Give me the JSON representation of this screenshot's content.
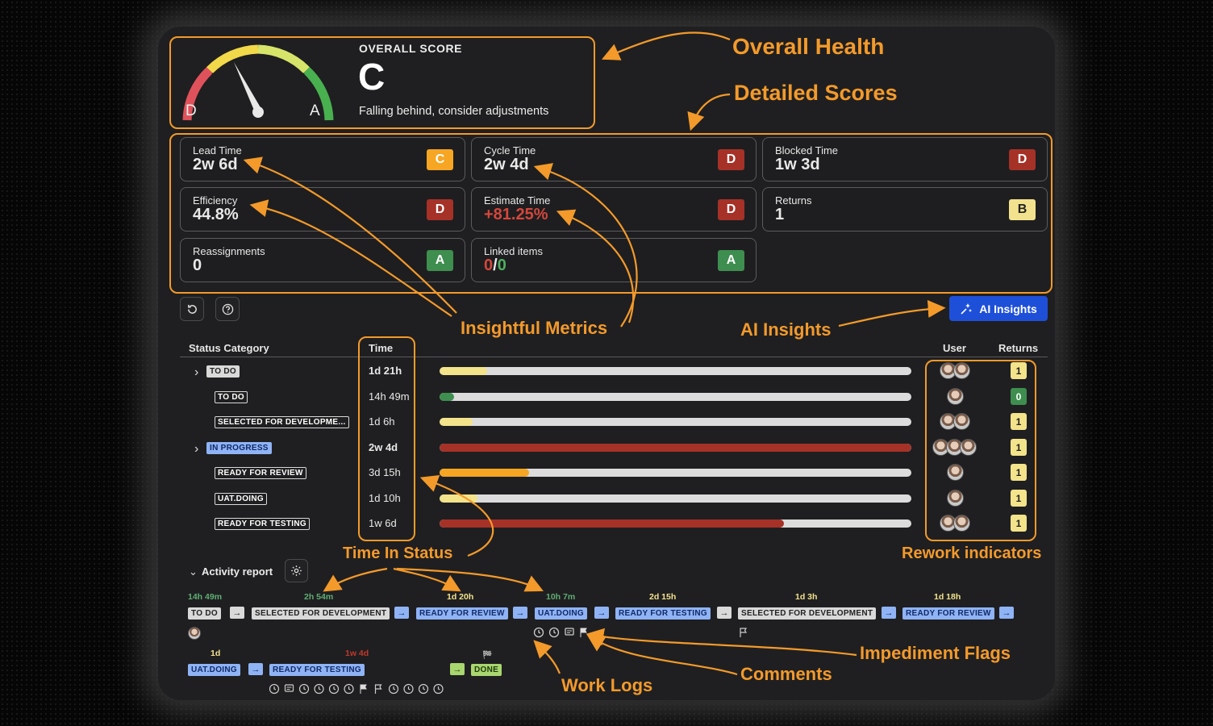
{
  "overall": {
    "heading": "OVERALL SCORE",
    "grade": "C",
    "message": "Falling behind, consider adjustments",
    "gauge_min": "D",
    "gauge_max": "A"
  },
  "metrics": [
    {
      "label": "Lead Time",
      "value": "2w 6d",
      "grade": "C"
    },
    {
      "label": "Cycle Time",
      "value": "2w 4d",
      "grade": "D"
    },
    {
      "label": "Blocked Time",
      "value": "1w 3d",
      "grade": "D"
    },
    {
      "label": "Efficiency",
      "value": "44.8%",
      "grade": "D"
    },
    {
      "label": "Estimate Time",
      "value": "+81.25%",
      "grade": "D"
    },
    {
      "label": "Returns",
      "value": "1",
      "grade": "B"
    },
    {
      "label": "Reassignments",
      "value": "0",
      "grade": "A"
    },
    {
      "label": "Linked items",
      "value_a": "0",
      "sep": "/",
      "value_b": "0",
      "grade": "A"
    }
  ],
  "toolbar": {
    "ai_insights": "AI Insights",
    "refresh_icon": "refresh-icon",
    "help_icon": "help-icon",
    "sparkle_icon": "sparkle-icon"
  },
  "table": {
    "headers": {
      "status": "Status Category",
      "time": "Time",
      "user": "User",
      "returns": "Returns"
    },
    "rows": [
      {
        "status": "TO DO",
        "time": "1d 21h",
        "fill": 0.1,
        "color": "#f3e38b",
        "returns": "1",
        "expandable": true,
        "style": "grey",
        "bold": true
      },
      {
        "status": "TO DO",
        "time": "14h 49m",
        "fill": 0.03,
        "color": "#3e8e4f",
        "returns": "0",
        "style": "outline"
      },
      {
        "status": "SELECTED FOR DEVELOPME...",
        "time": "1d 6h",
        "fill": 0.07,
        "color": "#f3e38b",
        "returns": "1",
        "style": "outline"
      },
      {
        "status": "IN PROGRESS",
        "time": "2w 4d",
        "fill": 1.0,
        "color": "#a63127",
        "returns": "1",
        "expandable": true,
        "style": "blue",
        "bold": true
      },
      {
        "status": "READY FOR REVIEW",
        "time": "3d 15h",
        "fill": 0.19,
        "color": "#f6a623",
        "returns": "1",
        "style": "outline"
      },
      {
        "status": "UAT.DOING",
        "time": "1d 10h",
        "fill": 0.08,
        "color": "#f3e38b",
        "returns": "1",
        "style": "outline"
      },
      {
        "status": "READY FOR TESTING",
        "time": "1w 6d",
        "fill": 0.73,
        "color": "#a63127",
        "returns": "1",
        "style": "outline"
      }
    ]
  },
  "activity": {
    "title": "Activity report",
    "settings_icon": "gear-icon",
    "row1": [
      {
        "dur": "14h 49m",
        "durColor": "#5fae73",
        "status": "TO DO",
        "style": "grey"
      },
      {
        "dur": "2h 54m",
        "durColor": "#5fae73",
        "status": "SELECTED FOR DEVELOPMENT",
        "style": "grey"
      },
      {
        "dur": "1d 20h",
        "durColor": "#f3e38b",
        "status": "READY FOR REVIEW",
        "style": "blue"
      },
      {
        "dur": "10h 7m",
        "durColor": "#5fae73",
        "status": "UAT.DOING",
        "style": "blue"
      },
      {
        "dur": "2d 15h",
        "durColor": "#f3e38b",
        "status": "READY FOR TESTING",
        "style": "blue"
      },
      {
        "dur": "1d 3h",
        "durColor": "#f3e38b",
        "status": "SELECTED FOR DEVELOPMENT",
        "style": "grey"
      },
      {
        "dur": "1d 18h",
        "durColor": "#f3e38b",
        "status": "READY FOR REVIEW",
        "style": "blue"
      }
    ],
    "row2": [
      {
        "dur": "1d",
        "durColor": "#f3e38b",
        "status": "UAT.DOING",
        "style": "blue"
      },
      {
        "dur": "1w 4d",
        "durColor": "#c0392b",
        "status": "READY FOR TESTING",
        "style": "blue"
      },
      {
        "dur": "",
        "durColor": "#ccc",
        "status": "DONE",
        "style": "green"
      }
    ]
  },
  "annotations": {
    "overall_health": "Overall Health",
    "detailed_scores": "Detailed Scores",
    "insightful_metrics": "Insightful Metrics",
    "ai_insights": "AI Insights",
    "time_in_status": "Time In Status",
    "rework_indicators": "Rework indicators",
    "impediment_flags": "Impediment Flags",
    "comments": "Comments",
    "work_logs": "Work Logs"
  },
  "colors": {
    "accent": "#f39a2b",
    "primary": "#1d4fd8",
    "red": "#a63127",
    "orange": "#f6a623",
    "yellow": "#f3e38b",
    "green": "#3e8e4f"
  }
}
